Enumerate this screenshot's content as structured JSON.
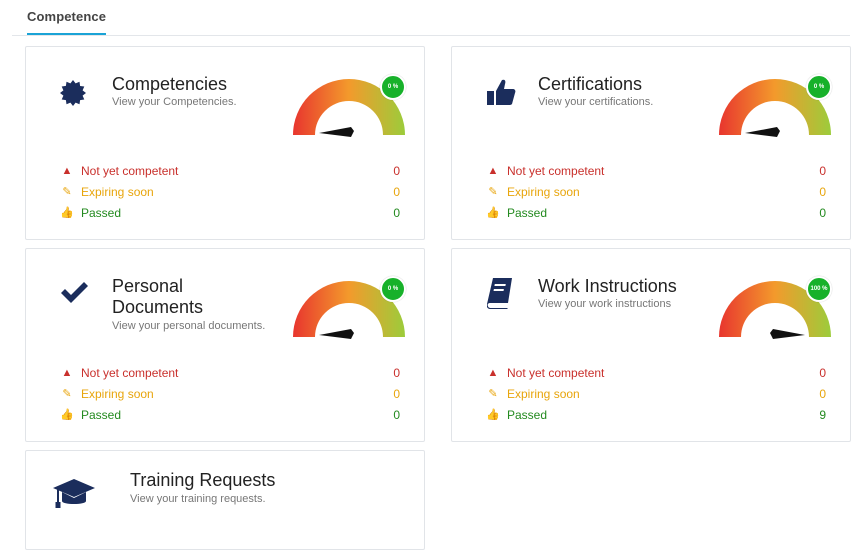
{
  "tabs": [
    {
      "label": "Competence"
    }
  ],
  "stat_labels": {
    "not_competent": "Not yet competent",
    "expiring": "Expiring soon",
    "passed": "Passed"
  },
  "colors": {
    "tab_accent": "#1aa3d6",
    "red": "#c9302c",
    "yellow": "#e8a50c",
    "green": "#238a1f",
    "icon_navy": "#1b2d5c",
    "badge": "#17b12a"
  },
  "cards": {
    "competencies": {
      "icon": "badge-seal-icon",
      "title": "Competencies",
      "subtitle": "View your Competencies.",
      "gauge_percent_label": "0 %",
      "gauge_value": 0,
      "not_competent": "0",
      "expiring": "0",
      "passed": "0"
    },
    "certifications": {
      "icon": "thumbs-up-icon",
      "title": "Certifications",
      "subtitle": "View your certifications.",
      "gauge_percent_label": "0 %",
      "gauge_value": 0,
      "not_competent": "0",
      "expiring": "0",
      "passed": "0"
    },
    "personal_documents": {
      "icon": "checkmark-icon",
      "title_line1": "Personal",
      "title_line2": "Documents",
      "subtitle": "View your personal documents.",
      "gauge_percent_label": "0 %",
      "gauge_value": 0,
      "not_competent": "0",
      "expiring": "0",
      "passed": "0"
    },
    "work_instructions": {
      "icon": "book-icon",
      "title": "Work Instructions",
      "subtitle": "View your work instructions",
      "gauge_percent_label": "100 %",
      "gauge_value": 100,
      "not_competent": "0",
      "expiring": "0",
      "passed": "9"
    },
    "training_requests": {
      "icon": "graduation-cap-icon",
      "title": "Training Requests",
      "subtitle": "View your training requests."
    }
  }
}
